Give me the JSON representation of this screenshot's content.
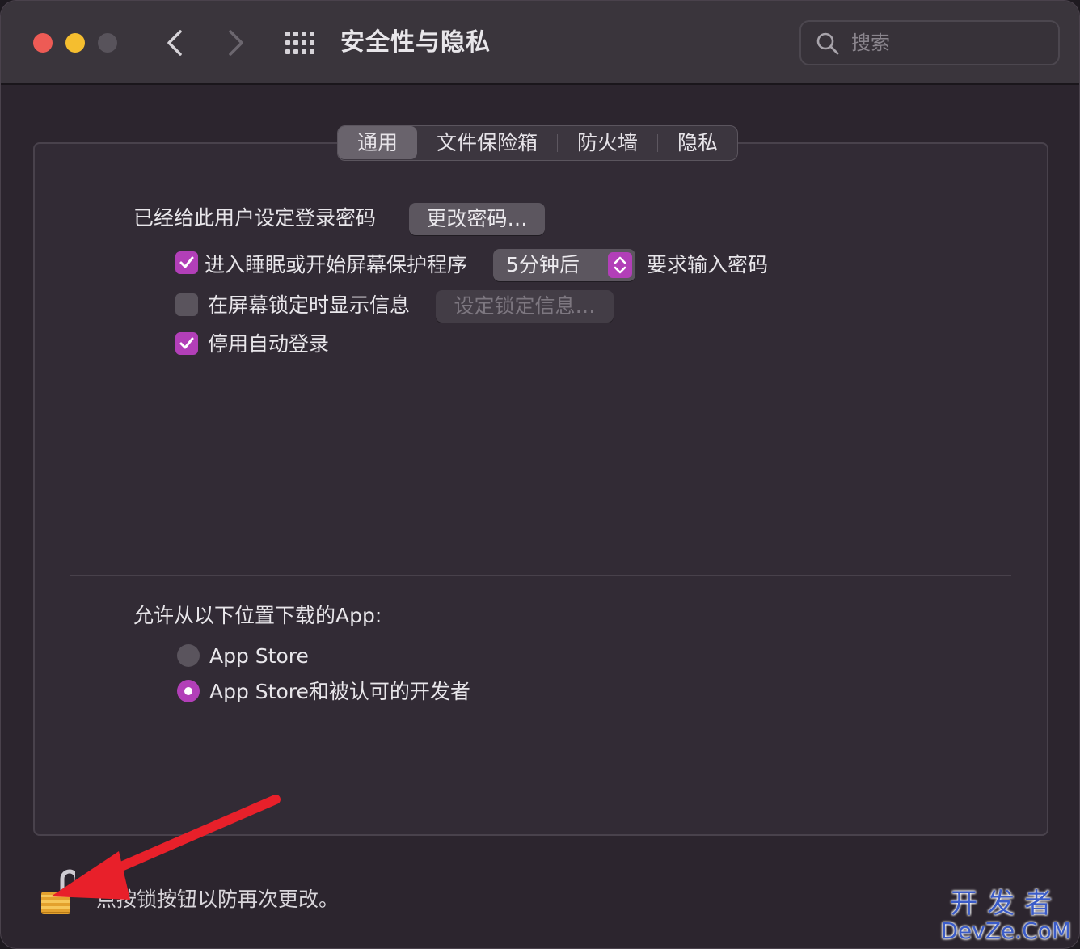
{
  "window": {
    "title": "安全性与隐私"
  },
  "search": {
    "placeholder": "搜索"
  },
  "tabs": [
    {
      "label": "通用",
      "active": true
    },
    {
      "label": "文件保险箱",
      "active": false
    },
    {
      "label": "防火墙",
      "active": false
    },
    {
      "label": "隐私",
      "active": false
    }
  ],
  "general": {
    "password_set_text": "已经给此用户设定登录密码",
    "change_password_button": "更改密码…",
    "require_password": {
      "checked": true,
      "prefix": "进入睡眠或开始屏幕保护程序",
      "delay_value": "5分钟后",
      "suffix": "要求输入密码"
    },
    "show_message": {
      "checked": false,
      "label": "在屏幕锁定时显示信息",
      "button": "设定锁定信息…"
    },
    "disable_auto_login": {
      "checked": true,
      "label": "停用自动登录"
    },
    "allow_apps_heading": "允许从以下位置下载的App:",
    "allow_options": [
      {
        "label": "App Store",
        "selected": false
      },
      {
        "label": "App Store和被认可的开发者",
        "selected": true
      }
    ]
  },
  "footer": {
    "lock_text": "点按锁按钮以防再次更改。"
  },
  "watermark": {
    "top": "开发者",
    "bottom": "DevZe.CoM"
  },
  "colors": {
    "accent": "#b23fb8",
    "annotation_arrow": "#e8202a"
  }
}
